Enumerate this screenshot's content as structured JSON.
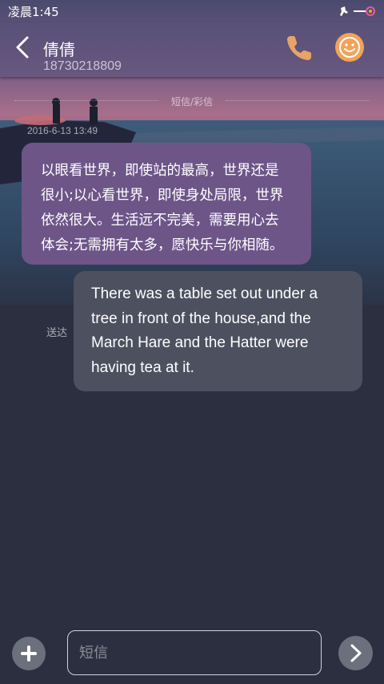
{
  "status_bar": {
    "time": "凌晨1:45"
  },
  "header": {
    "contact_name": "倩倩",
    "contact_number": "18730218809"
  },
  "conversation": {
    "separator_label": "短信/彩信",
    "timestamp": "2016-6-13 13:49",
    "messages": [
      {
        "direction": "incoming",
        "lines": [
          "以眼看世界，即使站的最高，世界还是",
          "很小;以心看世界，即使身处局限，世界",
          "依然很大。生活远不完美，需要用心去",
          "体会;无需拥有太多，愿快乐与你相随。"
        ]
      },
      {
        "direction": "outgoing",
        "lines": [
          "There was a table set out under a",
          "tree in front of the house,and the",
          "March Hare and the Hatter were",
          "having tea at it."
        ],
        "status": "送达"
      }
    ]
  },
  "composer": {
    "placeholder": "短信"
  },
  "colors": {
    "incoming_bubble": "#6d5588",
    "outgoing_bubble": "#4d505f",
    "avatar": "#f0a45a",
    "phone_icon": "#e8a466",
    "background": "#2b2f40"
  },
  "icons": {
    "back": "chevron-left-icon",
    "phone": "phone-icon",
    "avatar": "smiley-icon",
    "add": "plus-icon",
    "send": "chevron-right-icon"
  }
}
